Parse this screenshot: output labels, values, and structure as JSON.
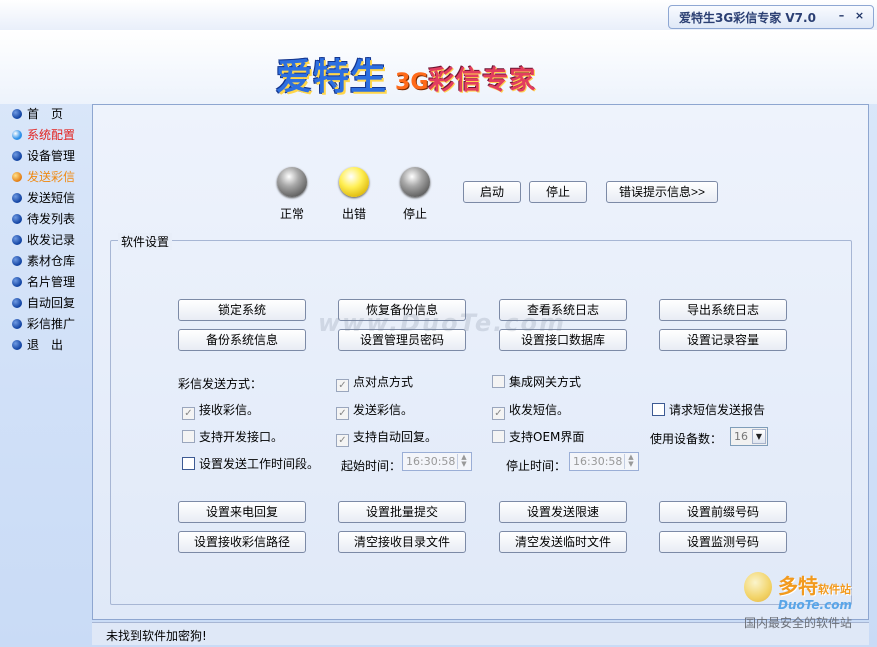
{
  "window": {
    "title": "爱特生3G彩信专家 V7.0",
    "minimize_glyph": "–",
    "close_glyph": "×"
  },
  "banner": {
    "logo_main": "爱特生",
    "logo_3g": "3G",
    "logo_sub": "彩信专家"
  },
  "nav": {
    "items": [
      {
        "label": "首　页"
      },
      {
        "label": "系统配置"
      },
      {
        "label": "设备管理"
      },
      {
        "label": "发送彩信"
      },
      {
        "label": "发送短信"
      },
      {
        "label": "待发列表"
      },
      {
        "label": "收发记录"
      },
      {
        "label": "素材仓库"
      },
      {
        "label": "名片管理"
      },
      {
        "label": "自动回复"
      },
      {
        "label": "彩信推广"
      },
      {
        "label": "退　出"
      }
    ]
  },
  "status_lights": {
    "normal": "正常",
    "error": "出错",
    "stopped": "停止"
  },
  "controls": {
    "start": "启动",
    "stop": "停止",
    "error_info": "错误提示信息>>"
  },
  "settings": {
    "group_title": "软件设置",
    "buttons_top": [
      "锁定系统",
      "恢复备份信息",
      "查看系统日志",
      "导出系统日志",
      "备份系统信息",
      "设置管理员密码",
      "设置接口数据库",
      "设置记录容量"
    ],
    "send_mode_label": "彩信发送方式：",
    "p2p_mode": "点对点方式",
    "gateway_mode": "集成网关方式",
    "receive_mms": "接收彩信。",
    "send_mms": "发送彩信。",
    "send_recv_sms": "收发短信。",
    "request_sms_report": "请求短信发送报告",
    "support_dev_interface": "支持开发接口。",
    "support_auto_reply": "支持自动回复。",
    "support_oem": "支持OEM界面",
    "device_count_label": "使用设备数：",
    "device_count": "16",
    "set_work_period": "设置发送工作时间段。",
    "start_time_label": "起始时间：",
    "start_time": "16:30:58",
    "stop_time_label": "停止时间：",
    "stop_time": "16:30:58",
    "buttons_bottom": [
      "设置来电回复",
      "设置批量提交",
      "设置发送限速",
      "设置前缀号码",
      "设置接收彩信路径",
      "清空接收目录文件",
      "清空发送临时文件",
      "设置监测号码"
    ]
  },
  "status_bar": {
    "message": "未找到软件加密狗!"
  },
  "watermarks": {
    "center": "www.DuoTe.com",
    "brand": "多特",
    "brand_small": "软件站",
    "brand_en": "DuoTe.com",
    "slogan": "国内最安全的软件站"
  }
}
